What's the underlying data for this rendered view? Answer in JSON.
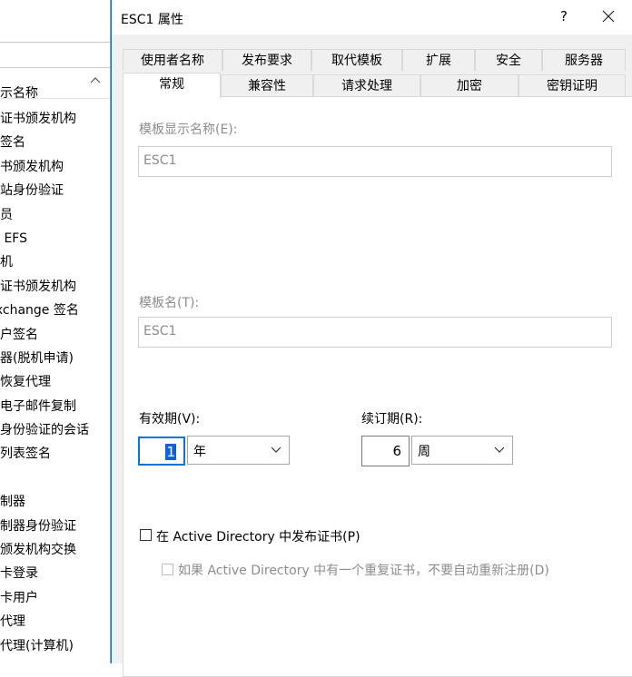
{
  "background_window": {
    "column_header": "显示名称",
    "items": [
      "根证书颁发机构",
      "码签名",
      "证书颁发机构",
      "车站身份验证",
      "理员",
      "本 EFS",
      "算机",
      "级证书颁发机构",
      "Exchange 签名",
      "用户签名",
      "由器(脱机申请)",
      "钥恢复代理",
      "录电子邮件复制",
      "过身份验证的会话",
      "任列表签名",
      "户",
      "控制器",
      "控制器身份验证",
      "书颁发机构交换",
      "能卡登录",
      "能卡用户",
      "册代理",
      "册代理(计算机)"
    ]
  },
  "dialog": {
    "title": "ESC1 属性",
    "help_label": "?",
    "tabs_row1": [
      "使用者名称",
      "发布要求",
      "取代模板",
      "扩展",
      "安全",
      "服务器"
    ],
    "tabs_row2": [
      "常规",
      "兼容性",
      "请求处理",
      "加密",
      "密钥证明"
    ],
    "active_tab": "常规",
    "general": {
      "display_name_label": "模板显示名称(E):",
      "display_name_value": "ESC1",
      "template_name_label": "模板名(T):",
      "template_name_value": "ESC1",
      "validity_label": "有效期(V):",
      "validity_value": "1",
      "validity_unit": "年",
      "renewal_label": "续订期(R):",
      "renewal_value": "6",
      "renewal_unit": "周",
      "publish_ad_label": "在 Active Directory 中发布证书(P)",
      "publish_ad_checked": false,
      "no_reenroll_label": "如果 Active Directory 中有一个重复证书，不要自动重新注册(D)",
      "no_reenroll_checked": false
    }
  },
  "colors": {
    "accent_blue": "#0b74d6",
    "selection_blue": "#0a64d8",
    "dialog_bg": "#f0f0f0",
    "disabled_text": "#8c8c8c"
  }
}
